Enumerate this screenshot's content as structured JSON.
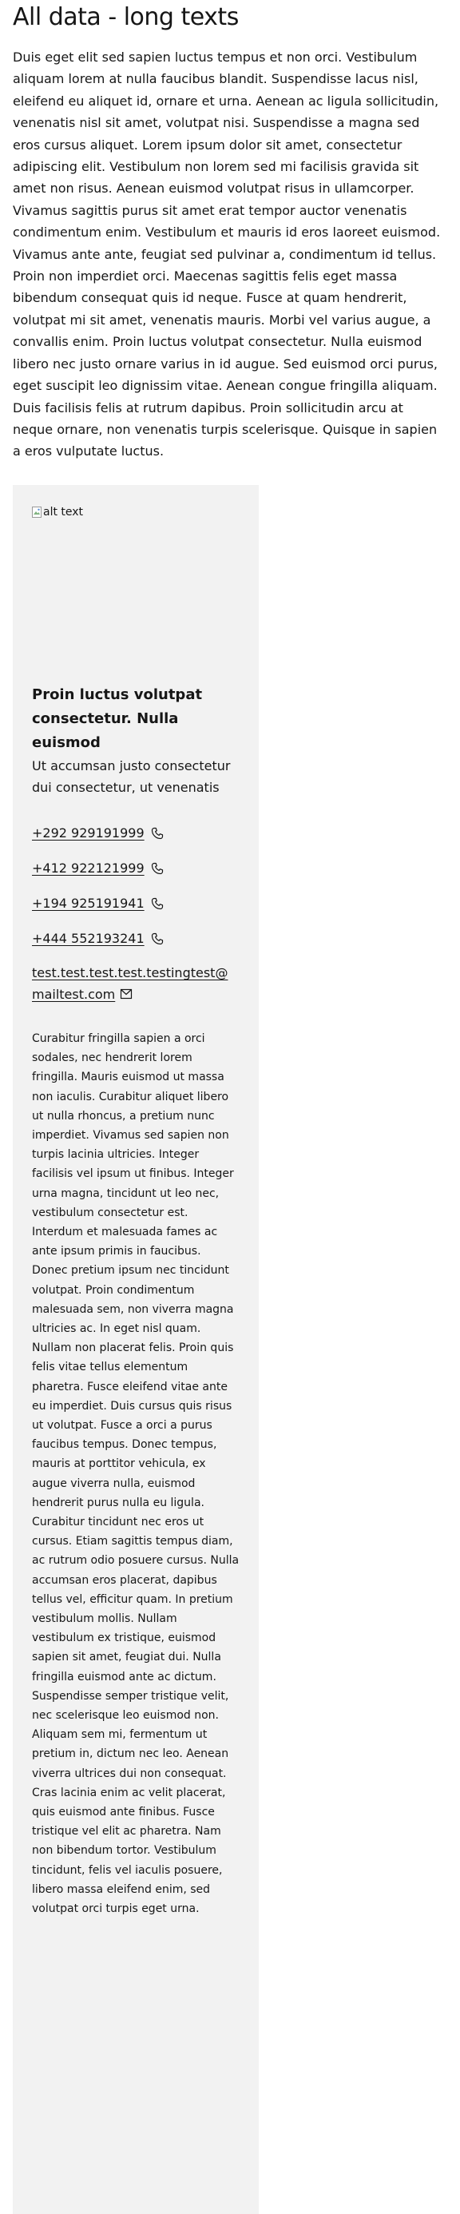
{
  "page": {
    "title": "All data - long texts",
    "intro": "Duis eget elit sed sapien luctus tempus et non orci. Vestibulum aliquam lorem at nulla faucibus blandit. Suspendisse lacus nisl, eleifend eu aliquet id, ornare et urna. Aenean ac ligula sollicitudin, venenatis nisl sit amet, volutpat nisi. Suspendisse a magna sed eros cursus aliquet. Lorem ipsum dolor sit amet, consectetur adipiscing elit. Vestibulum non lorem sed mi facilisis gravida sit amet non risus. Aenean euismod volutpat risus in ullamcorper. Vivamus sagittis purus sit amet erat tempor auctor venenatis condimentum enim. Vestibulum et mauris id eros laoreet euismod. Vivamus ante ante, feugiat sed pulvinar a, condimentum id tellus. Proin non imperdiet orci. Maecenas sagittis felis eget massa bibendum consequat quis id neque. Fusce at quam hendrerit, volutpat mi sit amet, venenatis mauris. Morbi vel varius augue, a convallis enim. Proin luctus volutpat consectetur. Nulla euismod libero nec justo ornare varius in id augue. Sed euismod orci purus, eget suscipit leo dignissim vitae. Aenean congue fringilla aliquam. Duis facilisis felis at rutrum dapibus. Proin sollicitudin arcu at neque ornare, non venenatis turpis scelerisque. Quisque in sapien a eros vulputate luctus."
  },
  "card": {
    "image_alt": "alt text",
    "title": "Proin luctus volutpat consectetur. Nulla euismod",
    "subtitle": "Ut accumsan justo consectetur dui consectetur, ut venenatis",
    "phones": [
      {
        "number": "+292 929191999",
        "icon": "phone-icon"
      },
      {
        "number": "+412 922121999",
        "icon": "phone-icon"
      },
      {
        "number": "+194 925191941",
        "icon": "phone-icon"
      },
      {
        "number": "+444 552193241",
        "icon": "phone-icon"
      }
    ],
    "email": {
      "address": "test.test.test.test.testingtest@mailtest.com",
      "icon": "mail-icon"
    },
    "body": "Curabitur fringilla sapien a orci sodales, nec hendrerit lorem fringilla. Mauris euismod ut massa non iaculis. Curabitur aliquet libero ut nulla rhoncus, a pretium nunc imperdiet. Vivamus sed sapien non turpis lacinia ultricies. Integer facilisis vel ipsum ut finibus. Integer urna magna, tincidunt ut leo nec, vestibulum consectetur est. Interdum et malesuada fames ac ante ipsum primis in faucibus. Donec pretium ipsum nec tincidunt volutpat. Proin condimentum malesuada sem, non viverra magna ultricies ac. In eget nisl quam. Nullam non placerat felis. Proin quis felis vitae tellus elementum pharetra. Fusce eleifend vitae ante eu imperdiet. Duis cursus quis risus ut volutpat. Fusce a orci a purus faucibus tempus. Donec tempus, mauris at porttitor vehicula, ex augue viverra nulla, euismod hendrerit purus nulla eu ligula. Curabitur tincidunt nec eros ut cursus. Etiam sagittis tempus diam, ac rutrum odio posuere cursus. Nulla accumsan eros placerat, dapibus tellus vel, efficitur quam. In pretium vestibulum mollis. Nullam vestibulum ex tristique, euismod sapien sit amet, feugiat dui. Nulla fringilla euismod ante ac dictum. Suspendisse semper tristique velit, nec scelerisque leo euismod non. Aliquam sem mi, fermentum ut pretium in, dictum nec leo. Aenean viverra ultrices dui non consequat. Cras lacinia enim ac velit placerat, quis euismod ante finibus. Fusce tristique vel elit ac pharetra. Nam non bibendum tortor. Vestibulum tincidunt, felis vel iaculis posuere, libero massa eleifend enim, sed volutpat orci turpis eget urna."
  }
}
